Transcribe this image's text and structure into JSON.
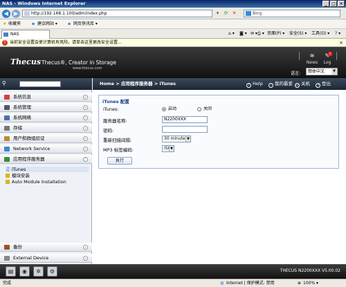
{
  "window": {
    "title": "NAS - Windows Internet Explorer"
  },
  "address_bar": {
    "url": "http://192.168.1.100/adm/index.php",
    "search_placeholder": "Bing"
  },
  "favorites_bar": {
    "favorites_label": "收藏夹",
    "items": [
      "建议网站 ▾",
      "网页快讯库 ▾"
    ]
  },
  "tab": {
    "title": "NAS"
  },
  "command_bar": {
    "page": "页面(P) ▾",
    "safety": "安全(S) ▾",
    "tools": "工具(O) ▾"
  },
  "info_bar": {
    "message": "当前安全设置会使计算机有风险。请单击这里更改安全设置..."
  },
  "app_header": {
    "logo": "Thecus",
    "brand": "Thecus®, Creator in Storage",
    "brand_url": "www.thecus.com",
    "news_label": "News",
    "log_label": "Log",
    "log_badge": "1",
    "language_label": "语言:",
    "language_value": "簡体中文"
  },
  "sidebar": {
    "categories": [
      {
        "label": "系统信息"
      },
      {
        "label": "系统管理"
      },
      {
        "label": "系统网络"
      },
      {
        "label": "存储"
      },
      {
        "label": "用户和群组验证"
      },
      {
        "label": "Network Service"
      },
      {
        "label": "应用程序服务器"
      }
    ],
    "subitems": [
      "iTunes",
      "模块安装",
      "Auto Module Installation"
    ],
    "bottom_categories": [
      {
        "label": "备份"
      },
      {
        "label": "External Device"
      }
    ]
  },
  "main": {
    "breadcrumb": "Home > 应用程序服务器 > iTunes",
    "links": {
      "help": "Help",
      "favorites": "我的最爱",
      "shutdown": "关机",
      "logout": "登出"
    },
    "panel": {
      "title": "iTunes 配置",
      "fields": {
        "itunes_label": "iTunes:",
        "enable_label": "启动",
        "disable_label": "关闭",
        "server_name_label": "服务器名称:",
        "server_name_value": "N2200XXX",
        "password_label": "密码:",
        "password_value": "",
        "rescan_label": "重新扫描间隔:",
        "rescan_value": "30 minutes",
        "mp3_label": "MP3 标签编码:",
        "mp3_value": "ISO"
      },
      "apply_label": "执行"
    }
  },
  "footer": {
    "version": "THECUS N2200XXX V5.00.02"
  },
  "status_bar": {
    "status": "完成",
    "zone": "Internet | 保护模式: 禁用",
    "zoom": "100% ▾"
  }
}
